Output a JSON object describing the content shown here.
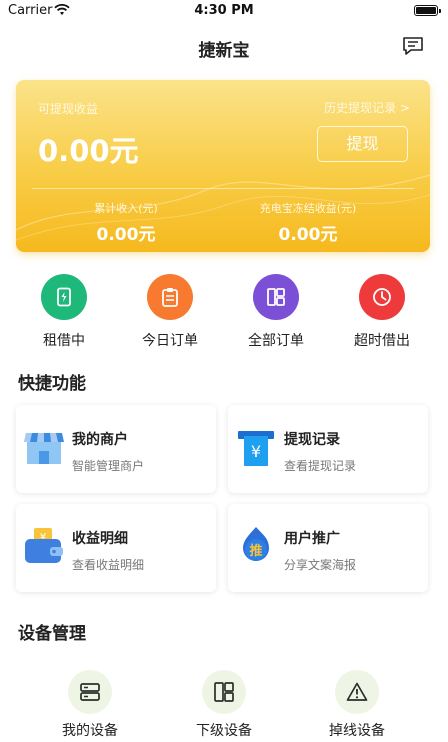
{
  "status_bar": {
    "carrier": "Carrier",
    "time": "4:30 PM"
  },
  "nav": {
    "title": "捷新宝"
  },
  "balance_card": {
    "withdrawable_label": "可提现收益",
    "history_link": "历史提现记录 >",
    "amount": "0.00元",
    "withdraw_button": "提现",
    "cumulative_income_label": "累计收入(元)",
    "cumulative_income_value": "0.00元",
    "frozen_income_label": "充电宝冻结收益(元)",
    "frozen_income_value": "0.00元"
  },
  "shortcuts": [
    {
      "label": "租借中",
      "icon": "device-icon",
      "color": "#1db87a"
    },
    {
      "label": "今日订单",
      "icon": "clipboard-icon",
      "color": "#f77a30"
    },
    {
      "label": "全部订单",
      "icon": "grid-icon",
      "color": "#7b4fd6"
    },
    {
      "label": "超时借出",
      "icon": "clock-icon",
      "color": "#ee3a3a"
    }
  ],
  "quick_functions": {
    "title": "快捷功能",
    "items": [
      {
        "title": "我的商户",
        "subtitle": "智能管理商户",
        "icon": "store-icon"
      },
      {
        "title": "提现记录",
        "subtitle": "查看提现记录",
        "icon": "yen-receipt-icon"
      },
      {
        "title": "收益明细",
        "subtitle": "查看收益明细",
        "icon": "wallet-icon"
      },
      {
        "title": "用户推广",
        "subtitle": "分享文案海报",
        "icon": "promote-icon",
        "badge": "推"
      }
    ]
  },
  "device_management": {
    "title": "设备管理",
    "items": [
      {
        "label": "我的设备",
        "icon": "server-icon"
      },
      {
        "label": "下级设备",
        "icon": "grid-icon"
      },
      {
        "label": "掉线设备",
        "icon": "warning-icon"
      }
    ]
  },
  "colors": {
    "accent": "#f8cc45",
    "device_circle": "#eef5e4",
    "device_icon": "#2d2d2d"
  }
}
